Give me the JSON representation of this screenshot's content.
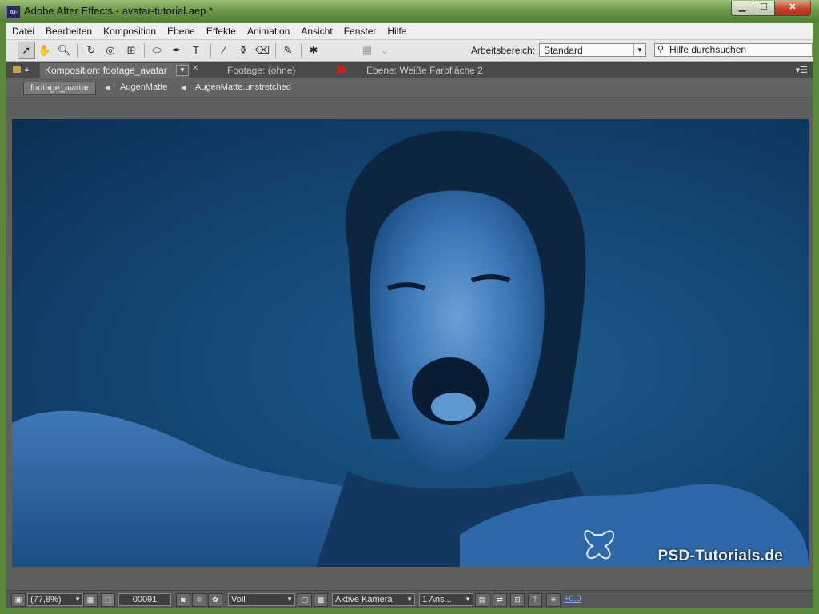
{
  "window": {
    "title": "Adobe After Effects - avatar-tutorial.aep *",
    "app_icon_text": "AE",
    "minimize_glyph": "▁",
    "maximize_glyph": "☐",
    "close_glyph": "✕"
  },
  "menu": [
    "Datei",
    "Bearbeiten",
    "Komposition",
    "Ebene",
    "Effekte",
    "Animation",
    "Ansicht",
    "Fenster",
    "Hilfe"
  ],
  "toolbar": {
    "workspace_label": "Arbeitsbereich:",
    "workspace_value": "Standard",
    "search_placeholder": "Hilfe durchsuchen",
    "tools": [
      "selection-tool",
      "hand-tool",
      "zoom-tool",
      "rotate-tool",
      "orbit-camera-tool",
      "track-xy-tool",
      "track-z-tool",
      "ellipse-tool",
      "pen-tool",
      "text-tool",
      "brush-tool",
      "clone-stamp-tool",
      "eraser-tool",
      "roto-brush-tool",
      "puppet-pin-tool"
    ]
  },
  "tabs": {
    "composition": "Komposition: footage_avatar",
    "footage": "Footage: (ohne)",
    "layer": "Ebene: Weiße Farbfläche 2"
  },
  "breadcrumbs": [
    "footage_avatar",
    "AugenMatte",
    "AugenMatte.unstretched"
  ],
  "viewer": {
    "watermark": "PSD-Tutorials.de",
    "background_color": "#164a78"
  },
  "viewer_bar": {
    "zoom": "(77,8%)",
    "timecode": "00091",
    "resolution": "Voll",
    "camera": "Aktive Kamera",
    "views": "1 Ans...",
    "exposure": "+0,0"
  },
  "colors": {
    "titlebar": "#6e9a4c",
    "panel": "#5f5f5f",
    "accent_link": "#7fb2ff"
  }
}
